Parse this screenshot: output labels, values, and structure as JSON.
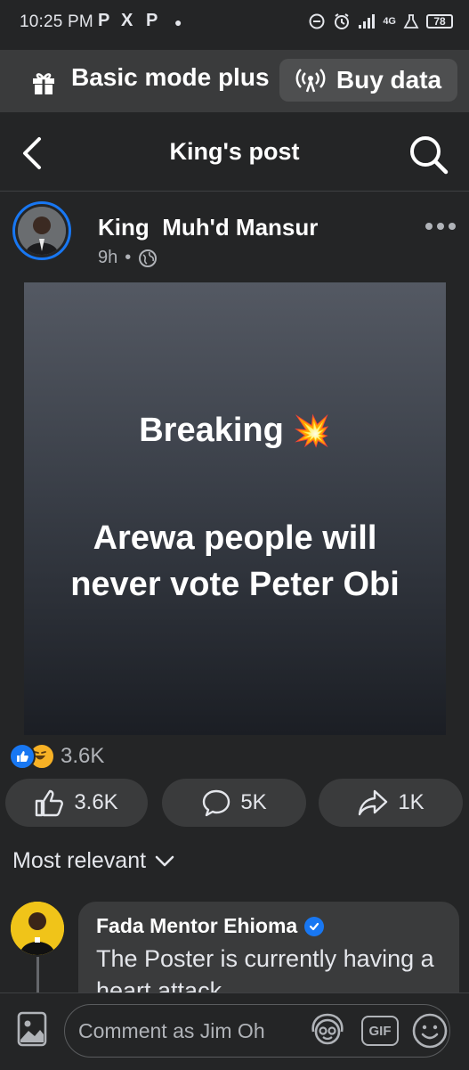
{
  "status_bar": {
    "time": "10:25 PM",
    "app_icons": [
      "P",
      "X",
      "P"
    ],
    "network": "4G",
    "battery": "78"
  },
  "mode_bar": {
    "label": "Basic mode plus",
    "buy_label": "Buy data"
  },
  "nav": {
    "title": "King's post"
  },
  "post": {
    "author": "King  Muh'd Mansur",
    "time": "9h",
    "dot": "•",
    "headline": "Breaking",
    "headline_emoji": "💥",
    "line1": "Arewa people will",
    "line2": "never vote Peter Obi",
    "reaction_count": "3.6K",
    "actions": {
      "like": "3.6K",
      "comment": "5K",
      "share": "1K"
    }
  },
  "comments": {
    "sort_label": "Most relevant",
    "items": [
      {
        "name": "Fada Mentor Ehioma",
        "text": "The Poster is currently having a heart attack"
      }
    ]
  },
  "composer": {
    "placeholder": "Comment as Jim Oh",
    "gif_label": "GIF"
  },
  "colors": {
    "background": "#242526",
    "surface": "#3a3b3c",
    "accent": "#1877f2",
    "text_primary": "#e4e6eb",
    "text_secondary": "#b0b3b8"
  }
}
